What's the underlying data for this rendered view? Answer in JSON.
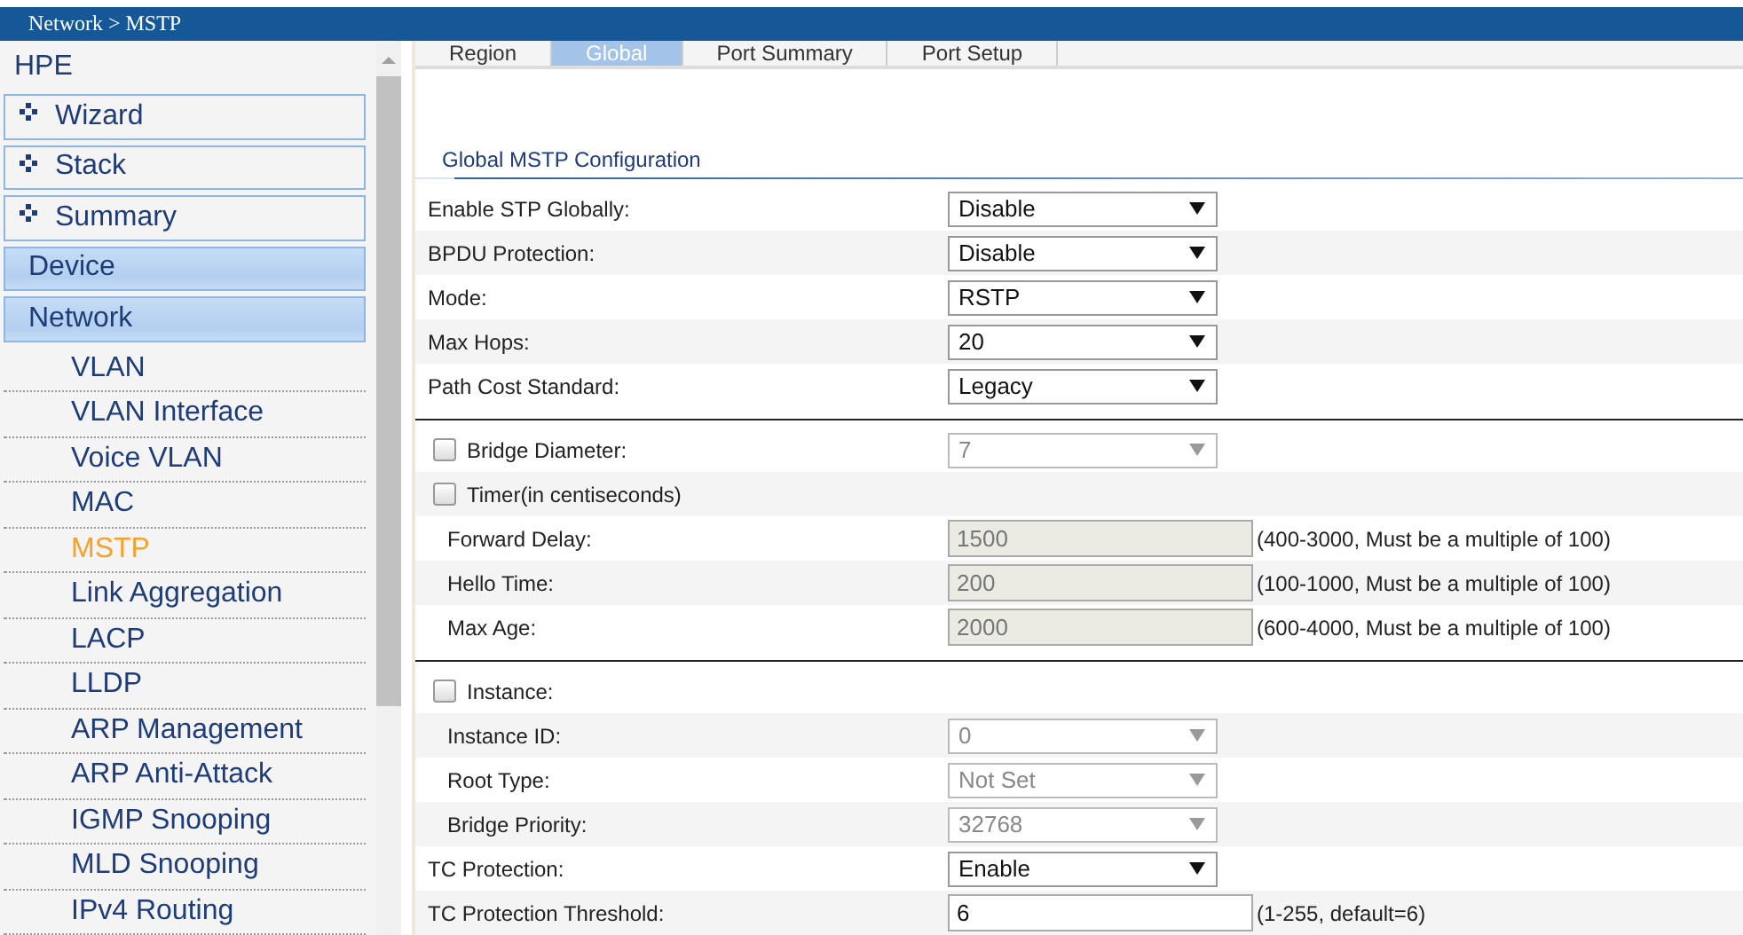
{
  "breadcrumb": "Network > MSTP",
  "sidebar": {
    "title": "HPE",
    "items": [
      {
        "label": "Wizard",
        "kind": "group"
      },
      {
        "label": "Stack",
        "kind": "group"
      },
      {
        "label": "Summary",
        "kind": "group"
      },
      {
        "label": "Device",
        "kind": "category"
      },
      {
        "label": "Network",
        "kind": "category",
        "children": [
          {
            "label": "VLAN",
            "selected": false
          },
          {
            "label": "VLAN Interface",
            "selected": false
          },
          {
            "label": "Voice VLAN",
            "selected": false
          },
          {
            "label": "MAC",
            "selected": false
          },
          {
            "label": "MSTP",
            "selected": true
          },
          {
            "label": "Link Aggregation",
            "selected": false
          },
          {
            "label": "LACP",
            "selected": false
          },
          {
            "label": "LLDP",
            "selected": false
          },
          {
            "label": "ARP Management",
            "selected": false
          },
          {
            "label": "ARP Anti-Attack",
            "selected": false
          },
          {
            "label": "IGMP Snooping",
            "selected": false
          },
          {
            "label": "MLD Snooping",
            "selected": false
          },
          {
            "label": "IPv4 Routing",
            "selected": false
          }
        ]
      }
    ]
  },
  "tabs": [
    {
      "label": "Region",
      "selected": false
    },
    {
      "label": "Global",
      "selected": true
    },
    {
      "label": "Port Summary",
      "selected": false
    },
    {
      "label": "Port Setup",
      "selected": false
    }
  ],
  "section_title": "Global MSTP Configuration",
  "groups": [
    [
      {
        "kind": "select",
        "label": "Enable STP Globally:",
        "value": "Disable",
        "disabled": false
      },
      {
        "kind": "select",
        "label": "BPDU Protection:",
        "value": "Disable",
        "disabled": false
      },
      {
        "kind": "select",
        "label": "Mode:",
        "value": "RSTP",
        "disabled": false
      },
      {
        "kind": "select",
        "label": "Max Hops:",
        "value": "20",
        "disabled": false
      },
      {
        "kind": "select",
        "label": "Path Cost Standard:",
        "value": "Legacy",
        "disabled": false
      }
    ],
    [
      {
        "kind": "checkbox",
        "label": "Bridge Diameter:",
        "checked": false,
        "value": "7",
        "disabled": true
      },
      {
        "kind": "checkbox",
        "label": "Timer(in centiseconds)",
        "checked": false,
        "children": [
          {
            "kind": "input",
            "label": "Forward Delay:",
            "value": "1500",
            "disabled": true,
            "hint": "(400-3000, Must be a multiple of 100)"
          },
          {
            "kind": "input",
            "label": "Hello Time:",
            "value": "200",
            "disabled": true,
            "hint": "(100-1000, Must be a multiple of 100)"
          },
          {
            "kind": "input",
            "label": "Max Age:",
            "value": "2000",
            "disabled": true,
            "hint": "(600-4000, Must be a multiple of 100)"
          }
        ]
      }
    ],
    [
      {
        "kind": "checkbox",
        "label": "Instance:",
        "checked": false,
        "children": [
          {
            "kind": "select",
            "label": "Instance ID:",
            "value": "0",
            "disabled": true
          },
          {
            "kind": "select",
            "label": "Root Type:",
            "value": "Not Set",
            "disabled": true
          },
          {
            "kind": "select",
            "label": "Bridge Priority:",
            "value": "32768",
            "disabled": true
          }
        ]
      },
      {
        "kind": "select",
        "label": "TC Protection:",
        "value": "Enable",
        "disabled": false
      },
      {
        "kind": "input",
        "label": "TC Protection Threshold:",
        "value": "6",
        "disabled": false,
        "hint": "(1-255, default=6)"
      }
    ]
  ]
}
